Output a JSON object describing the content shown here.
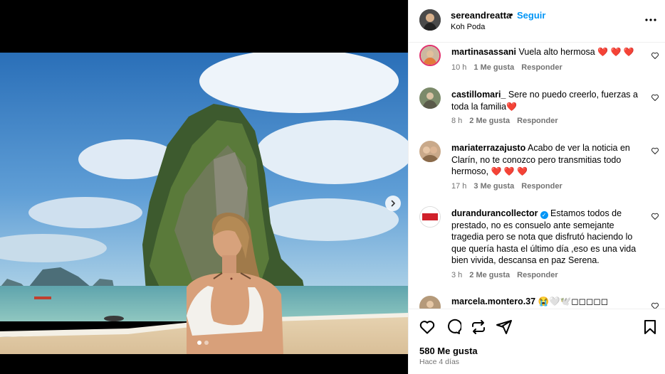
{
  "post": {
    "username": "sereandreatta",
    "follow_label": "Seguir",
    "separator": "•",
    "location": "Koh Poda",
    "likes": "580 Me gusta",
    "time_ago": "Hace 4 días",
    "carousel": {
      "slides": 2,
      "active": 1
    }
  },
  "comments": [
    {
      "user": "martinasassani",
      "text": "Vuela alto hermosa",
      "hearts": "❤️ ❤️ ❤️",
      "time": "10 h",
      "likes": "1 Me gusta",
      "reply": "Responder"
    },
    {
      "user": "castillomari_",
      "text": "Sere no puedo creerlo, fuerzas a toda la familia",
      "hearts": "❤️",
      "time": "8 h",
      "likes": "2 Me gusta",
      "reply": "Responder"
    },
    {
      "user": "mariaterrazajusto",
      "text": "Acabo de ver la noticia en Clarín, no te conozco pero transmitias todo hermoso,",
      "hearts": "❤️ ❤️ ❤️",
      "time": "17 h",
      "likes": "3 Me gusta",
      "reply": "Responder"
    },
    {
      "user": "durandurancollector",
      "text": "Estamos todos de prestado, no es consuelo ante semejante tragedia pero se nota que disfrutó haciendo lo que quería hasta el último día ,eso es una vida bien vivida, descansa en paz Serena.",
      "time": "3 h",
      "likes": "2 Me gusta",
      "reply": "Responder",
      "avatar_text": "DURAN DURAN"
    },
    {
      "user": "marcela.montero.37",
      "text": "😭🤍🕊️◻◻◻◻◻"
    }
  ],
  "colors": {
    "accent": "#0095f6",
    "heart": "#d9163f",
    "muted": "#737373"
  },
  "icons": [
    "more-icon",
    "heart-icon",
    "comment-icon",
    "repost-icon",
    "share-icon",
    "save-icon",
    "chevron-right-icon"
  ]
}
